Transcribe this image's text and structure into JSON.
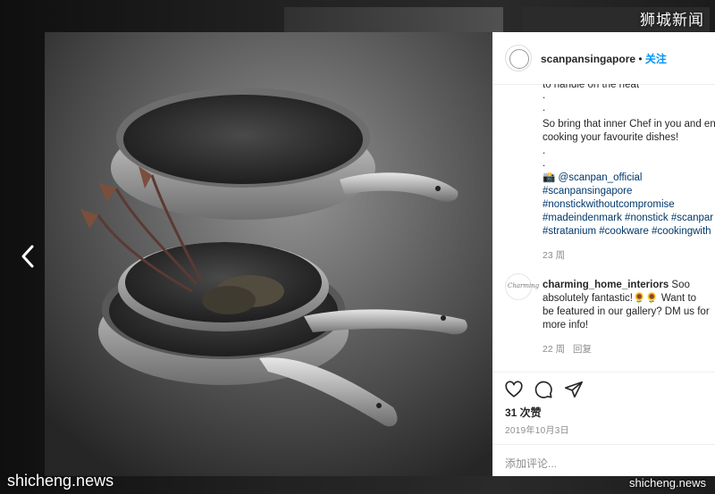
{
  "watermarks": {
    "top_right": "狮城新闻",
    "bottom_left": "shicheng.news",
    "bottom_right": "shicheng.news"
  },
  "post": {
    "owner": "scanpansingapore",
    "separator": "•",
    "follow_label": "关注",
    "caption_lines": [
      "to handle on the heat",
      ".",
      ".",
      "So bring that inner Chef in you and enj",
      "cooking your favourite dishes!",
      ".",
      "."
    ],
    "mention_line": "📸 @scanpan_official",
    "hashtag_lines": [
      "#scanpansingapore",
      "#nonstickwithoutcompromise",
      "#madeindenmark #nonstick #scanpar",
      "#stratanium #cookware #cookingwith"
    ],
    "caption_age": "23 周"
  },
  "comment": {
    "author": "charming_home_interiors",
    "avatar_text": "Charming",
    "text_lines": [
      " Soo",
      "absolutely fantastic!🌻🌻 Want to",
      "be featured in our gallery? DM us for",
      "more info!"
    ],
    "age": "22 周",
    "reply_label": "回复"
  },
  "actions": {
    "icons": [
      "heart-icon",
      "comment-icon",
      "share-icon"
    ],
    "likes": "31 次赞",
    "date": "2019年10月3日",
    "add_comment_placeholder": "添加评论..."
  },
  "colors": {
    "link": "#00376b",
    "follow": "#0095f6",
    "muted": "#8e8e8e",
    "text": "#262626"
  }
}
